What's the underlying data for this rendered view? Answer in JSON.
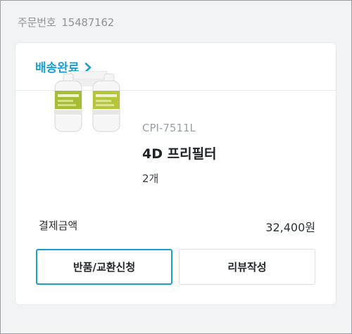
{
  "order": {
    "label": "주문번호",
    "number": "15487162"
  },
  "card": {
    "status_label": "배송완료",
    "product": {
      "model": "CPI-7511L",
      "name": "4D 프리필터",
      "quantity": "2개"
    },
    "payment": {
      "label": "결제금액",
      "amount": "32,400원"
    },
    "buttons": {
      "return_exchange": "반품/교환신청",
      "review": "리뷰작성"
    }
  },
  "colors": {
    "accent": "#1b9fd1",
    "background": "#f2f3f4",
    "card": "#ffffff"
  },
  "icons": {
    "status_chevron": "chevron-right-icon",
    "product_image": "filter-cartridge-image"
  }
}
